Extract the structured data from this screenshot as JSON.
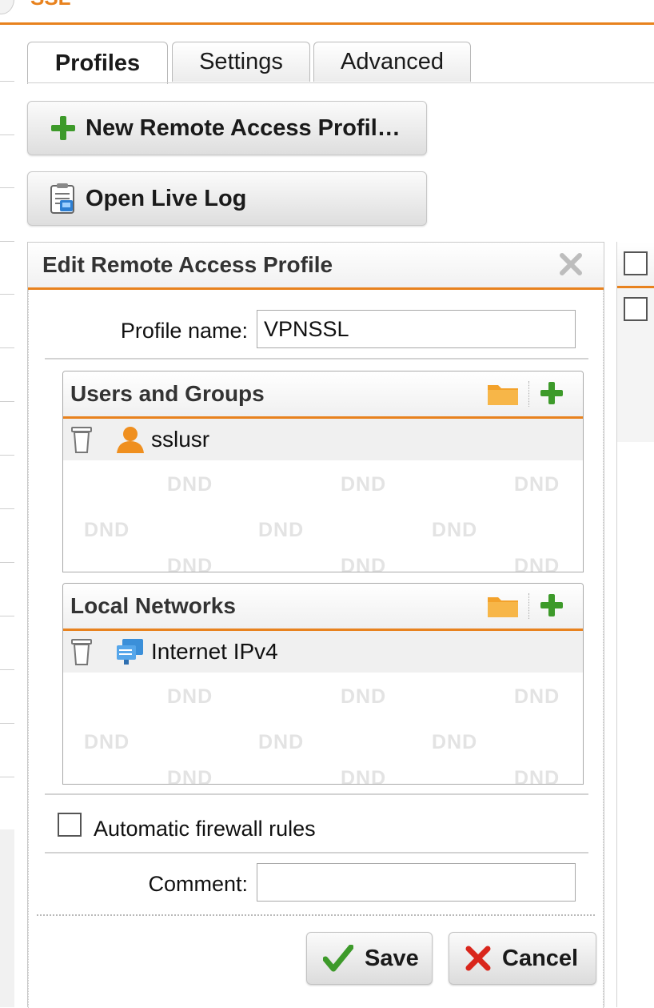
{
  "header": {
    "crumb": "SSL"
  },
  "tabs": [
    {
      "label": "Profiles",
      "active": true
    },
    {
      "label": "Settings",
      "active": false
    },
    {
      "label": "Advanced",
      "active": false
    }
  ],
  "toolbar": {
    "new_profile_label": "New Remote Access Profil…",
    "live_log_label": "Open Live Log"
  },
  "dialog": {
    "title": "Edit Remote Access Profile",
    "profile_name_label": "Profile name:",
    "profile_name_value": "VPNSSL",
    "users_panel": {
      "title": "Users and Groups",
      "items": [
        {
          "name": "sslusr",
          "icon": "user-icon"
        }
      ]
    },
    "networks_panel": {
      "title": "Local Networks",
      "items": [
        {
          "name": "Internet IPv4",
          "icon": "network-icon"
        }
      ]
    },
    "dnd_text": "DND",
    "auto_fw_label": "Automatic firewall rules",
    "auto_fw_checked": false,
    "comment_label": "Comment:",
    "comment_value": "",
    "save_label": "Save",
    "cancel_label": "Cancel"
  },
  "colors": {
    "accent": "#e8821e",
    "plus_green": "#3d9a2a",
    "cancel_red": "#d9261c",
    "folder_orange": "#f3a22b"
  }
}
